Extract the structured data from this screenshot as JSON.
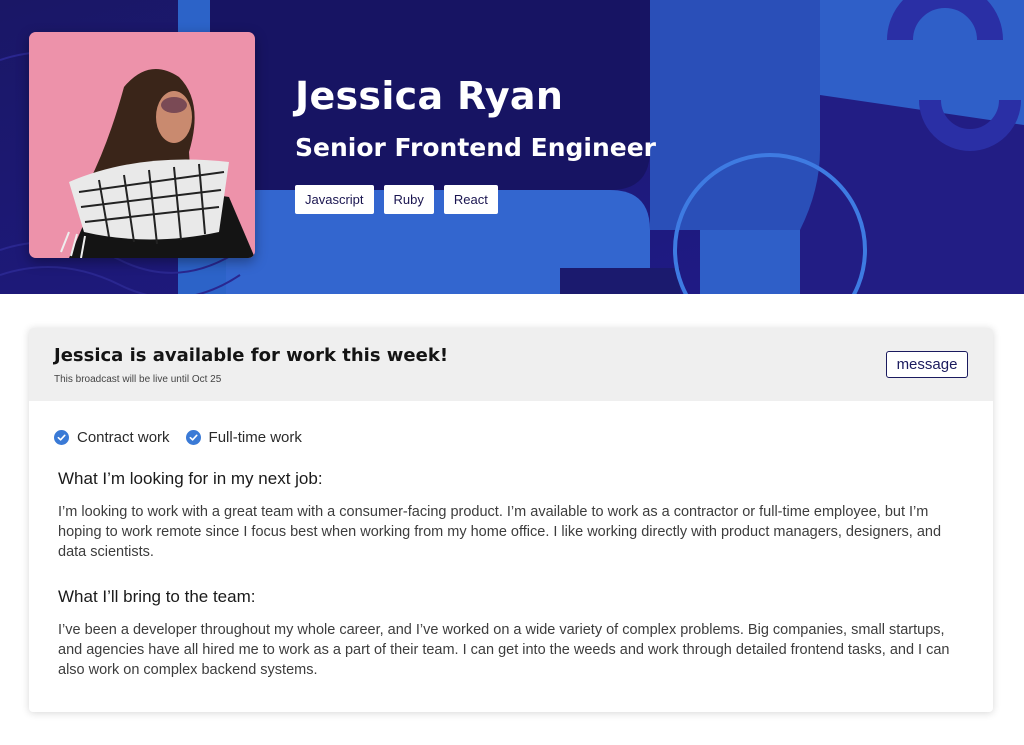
{
  "profile": {
    "name": "Jessica Ryan",
    "role": "Senior Frontend Engineer",
    "skills": [
      "Javascript",
      "Ruby",
      "React"
    ]
  },
  "availability": {
    "title": "Jessica is available for work this week!",
    "subtitle": "This broadcast will be live until Oct 25",
    "message_label": "message",
    "work_types": [
      "Contract work",
      "Full-time work"
    ]
  },
  "sections": [
    {
      "heading": "What I’m looking for in my next job:",
      "body": "I’m looking to work with a great team with a consumer-facing product. I’m available to work as a contractor or full-time employee, but I’m hoping to work remote since I focus best when working from my home office. I like working directly with product managers, designers, and data scientists."
    },
    {
      "heading": "What I’ll bring to the team:",
      "body": "I’ve been a developer throughout my whole career, and I’ve worked on a wide variety of complex problems. Big companies, small startups, and agencies have all hired me to work as a part of their team. I can get into the weeds and work through detailed frontend tasks, and I can also work on complex backend systems."
    }
  ],
  "colors": {
    "hero_bg": "#1c1a7a",
    "accent_blue": "#3a7ad6",
    "panel_header": "#efefef"
  },
  "icons": {
    "work_type_check": "check-circle-icon"
  }
}
